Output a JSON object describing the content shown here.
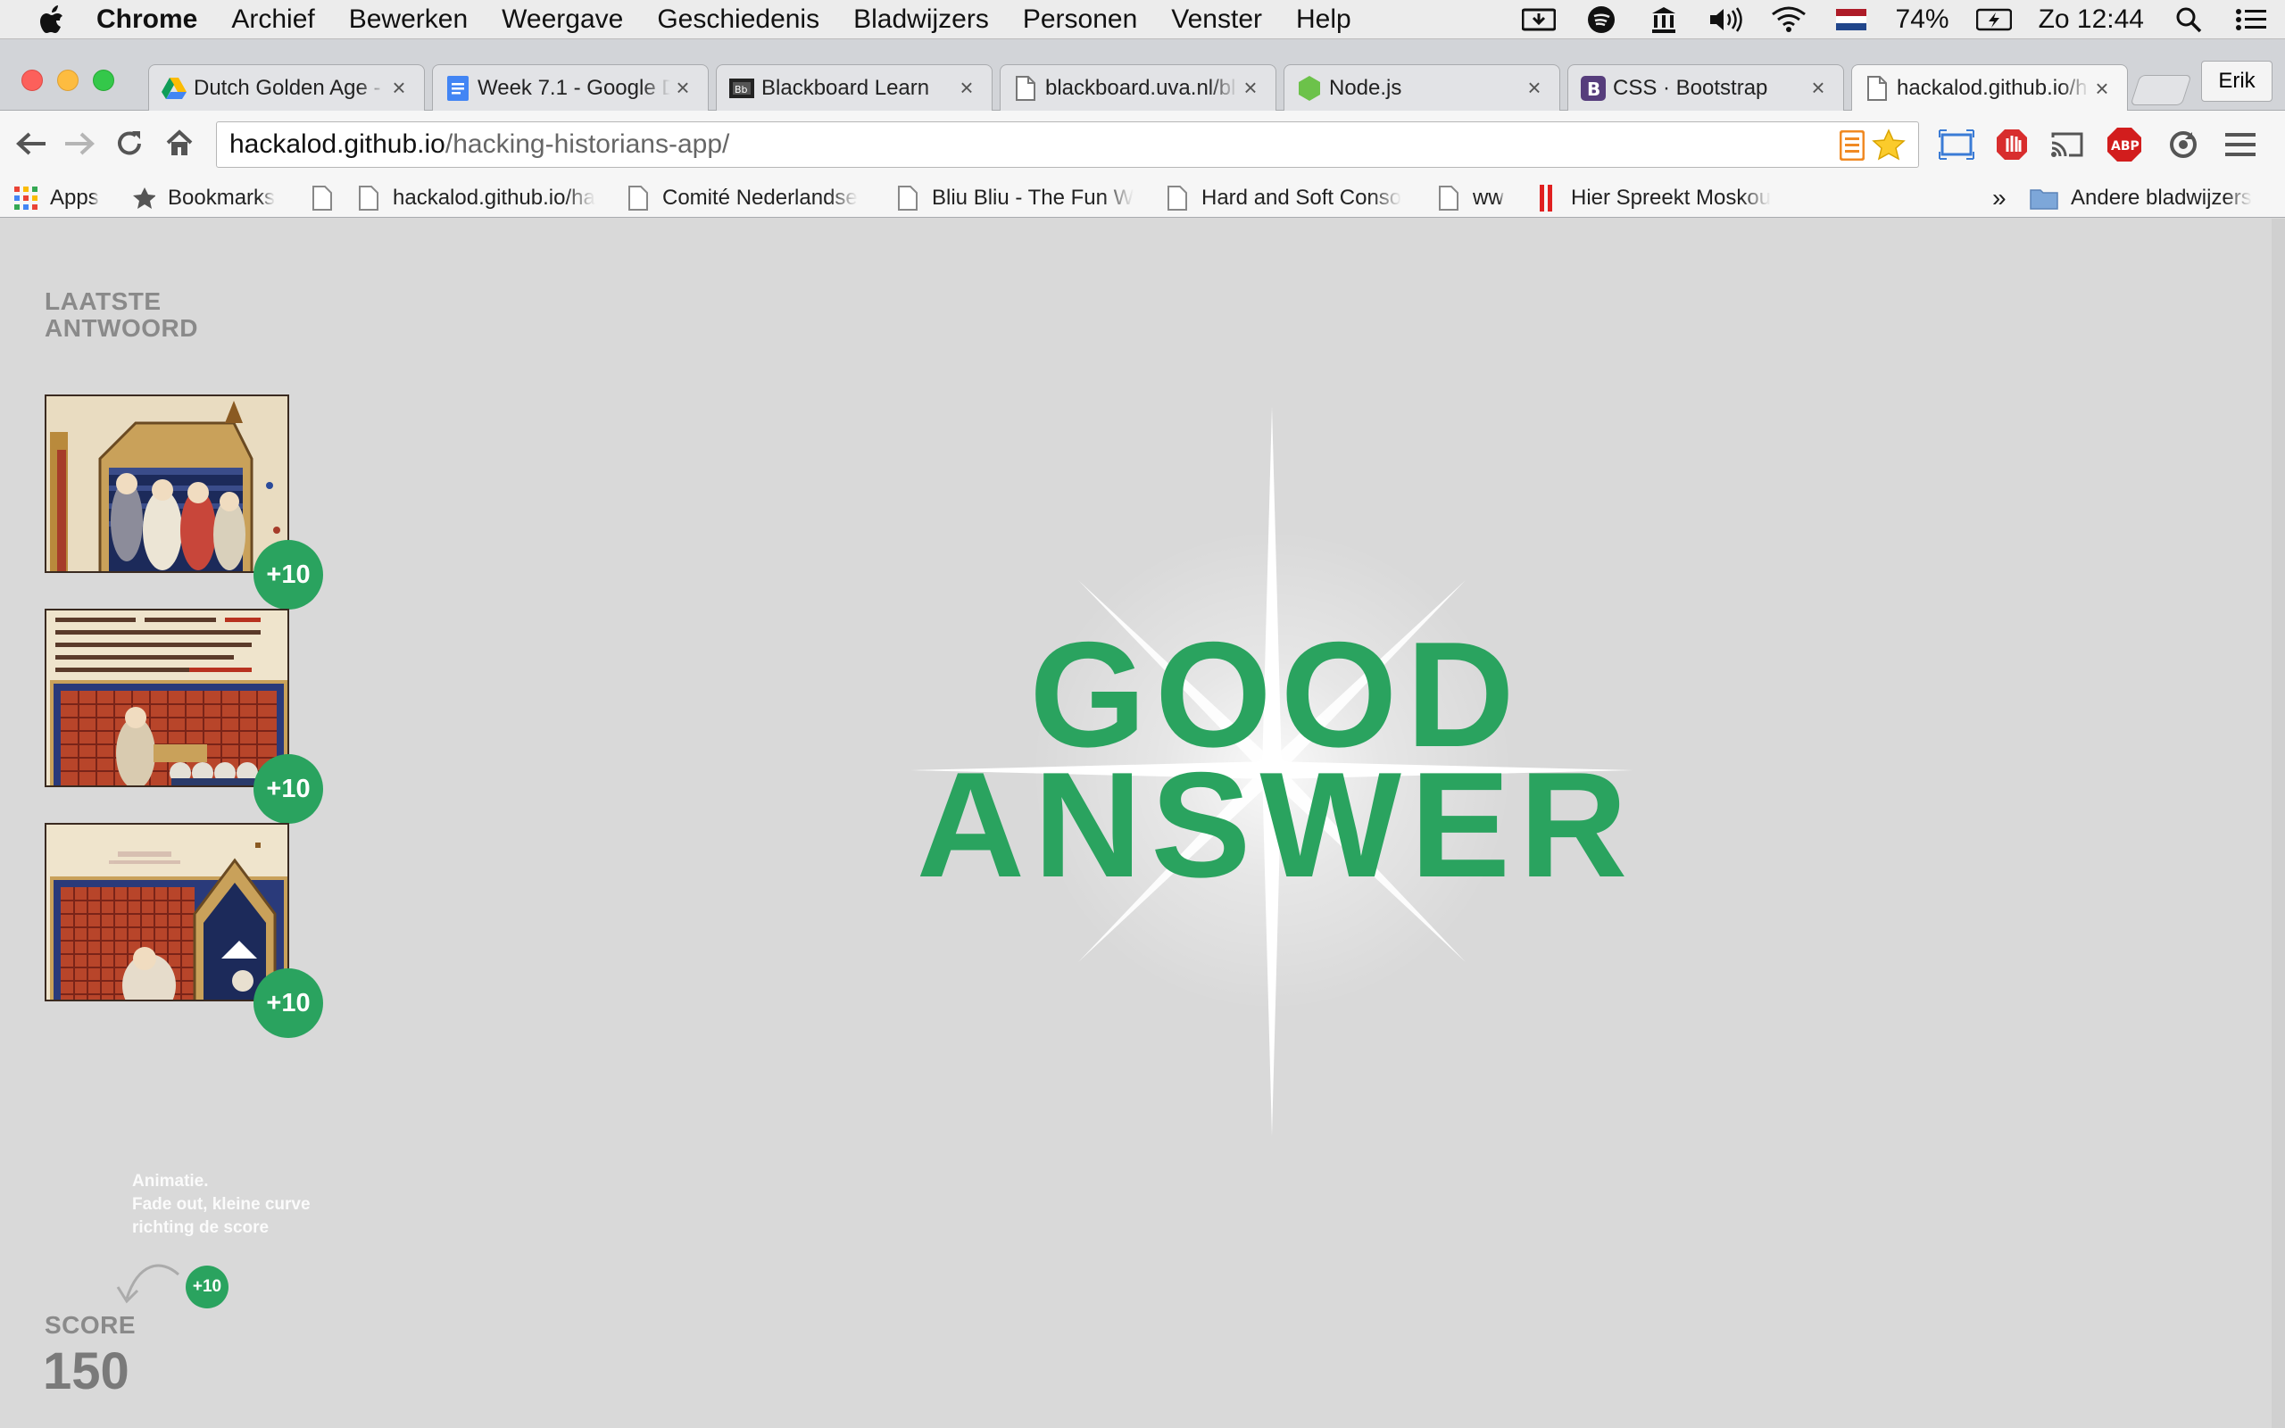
{
  "menubar": {
    "items": [
      "Chrome",
      "Archief",
      "Bewerken",
      "Weergave",
      "Geschiedenis",
      "Bladwijzers",
      "Personen",
      "Venster",
      "Help"
    ],
    "battery": "74%",
    "clock": "Zo 12:44"
  },
  "tabs": [
    {
      "title": "Dutch Golden Age -",
      "icon": "drive-icon"
    },
    {
      "title": "Week 7.1 - Google D",
      "icon": "docs-icon"
    },
    {
      "title": "Blackboard Learn",
      "icon": "blackboard-icon"
    },
    {
      "title": "blackboard.uva.nl/bl",
      "icon": "page-icon"
    },
    {
      "title": "Node.js",
      "icon": "nodejs-icon"
    },
    {
      "title": "CSS · Bootstrap",
      "icon": "bootstrap-icon"
    },
    {
      "title": "hackalod.github.io/h",
      "icon": "page-icon",
      "active": true
    }
  ],
  "profile_name": "Erik",
  "omnibox": {
    "host": "hackalod.github.io",
    "path": "/hacking-historians-app/"
  },
  "bookmarks": {
    "apps": "Apps",
    "items": [
      "Bookmarks",
      "",
      "hackalod.github.io/ha",
      "Comité Nederlandse",
      "Bliu Bliu - The Fun W",
      "Hard and Soft Conso",
      "ww",
      "Hier Spreekt Moskou"
    ],
    "overflow": "»",
    "other": "Andere bladwijzers"
  },
  "page": {
    "last_answer_label": [
      "LAATSTE",
      "ANTWOORD"
    ],
    "answers": [
      {
        "points": "+10"
      },
      {
        "points": "+10"
      },
      {
        "points": "+10"
      }
    ],
    "note": [
      "Animatie.",
      "Fade out, kleine curve",
      "richting de score"
    ],
    "note_badge": "+10",
    "score_label": "SCORE",
    "score_value": "150",
    "headline": [
      "GOOD",
      "ANSWER"
    ]
  },
  "colors": {
    "accent_green": "#2aa35f",
    "page_bg": "#d9d9d9"
  }
}
